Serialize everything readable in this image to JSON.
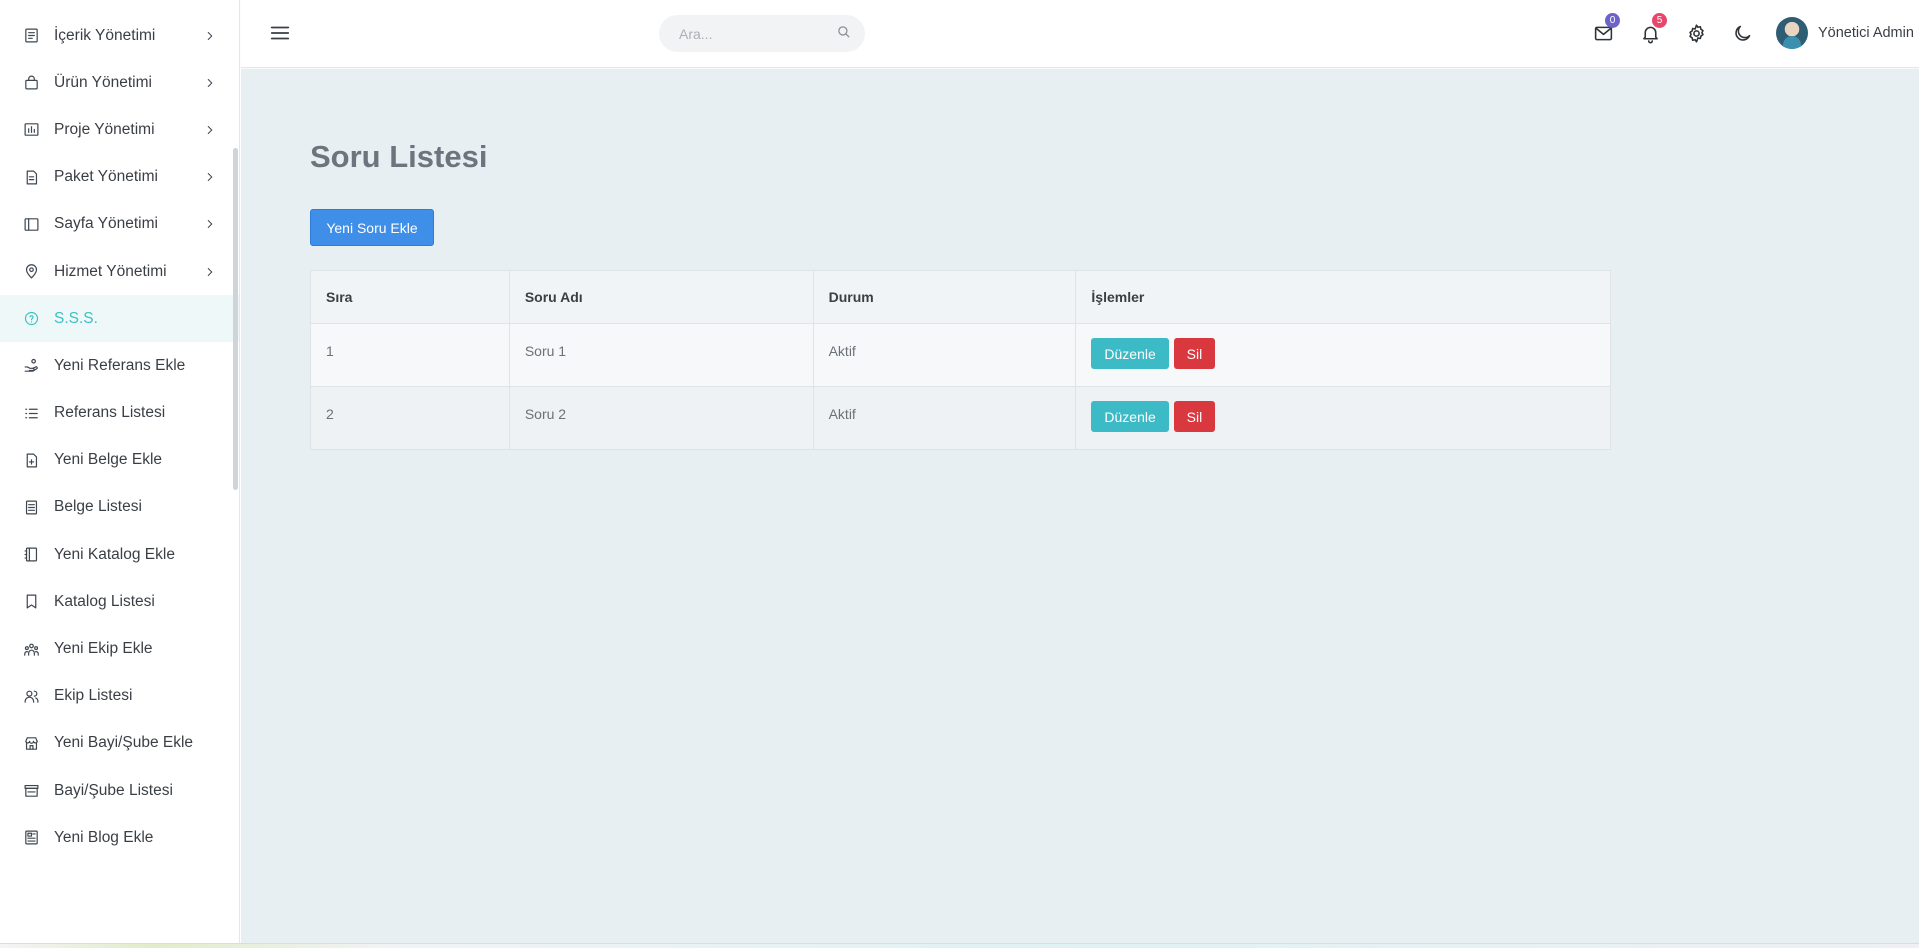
{
  "sidebar": {
    "items": [
      {
        "label": "İçerik Yönetimi",
        "icon": "document-list-icon",
        "has_chevron": true
      },
      {
        "label": "Ürün Yönetimi",
        "icon": "shopping-bag-icon",
        "has_chevron": true
      },
      {
        "label": "Proje Yönetimi",
        "icon": "bar-chart-icon",
        "has_chevron": true
      },
      {
        "label": "Paket Yönetimi",
        "icon": "file-text-icon",
        "has_chevron": true
      },
      {
        "label": "Sayfa Yönetimi",
        "icon": "layout-icon",
        "has_chevron": true
      },
      {
        "label": "Hizmet Yönetimi",
        "icon": "map-pin-icon",
        "has_chevron": true
      },
      {
        "label": "S.S.S.",
        "icon": "help-circle-icon",
        "has_chevron": false,
        "active": true
      },
      {
        "label": "Yeni Referans Ekle",
        "icon": "hand-coins-icon",
        "has_chevron": false
      },
      {
        "label": "Referans Listesi",
        "icon": "list-icon",
        "has_chevron": false
      },
      {
        "label": "Yeni Belge Ekle",
        "icon": "file-plus-icon",
        "has_chevron": false
      },
      {
        "label": "Belge Listesi",
        "icon": "document-list-icon",
        "has_chevron": false
      },
      {
        "label": "Yeni Katalog Ekle",
        "icon": "notebook-icon",
        "has_chevron": false
      },
      {
        "label": "Katalog Listesi",
        "icon": "bookmark-icon",
        "has_chevron": false
      },
      {
        "label": "Yeni Ekip Ekle",
        "icon": "team-icon",
        "has_chevron": false
      },
      {
        "label": "Ekip Listesi",
        "icon": "users-icon",
        "has_chevron": false
      },
      {
        "label": "Yeni Bayi/Şube Ekle",
        "icon": "store-icon",
        "has_chevron": false
      },
      {
        "label": "Bayi/Şube Listesi",
        "icon": "storefront-icon",
        "has_chevron": false
      },
      {
        "label": "Yeni Blog Ekle",
        "icon": "newspaper-icon",
        "has_chevron": false
      }
    ]
  },
  "header": {
    "search_placeholder": "Ara...",
    "mail_count": "0",
    "notification_count": "5",
    "user_name": "Yönetici Admin"
  },
  "main": {
    "title": "Soru Listesi",
    "add_button": "Yeni Soru Ekle",
    "table": {
      "headers": [
        "Sıra",
        "Soru Adı",
        "Durum",
        "İşlemler"
      ],
      "rows": [
        {
          "order": "1",
          "name": "Soru 1",
          "status": "Aktif",
          "edit": "Düzenle",
          "delete": "Sil"
        },
        {
          "order": "2",
          "name": "Soru 2",
          "status": "Aktif",
          "edit": "Düzenle",
          "delete": "Sil"
        }
      ]
    }
  },
  "colors": {
    "accent": "#3ec1c4",
    "primary_button": "#3f8ee8",
    "edit_button": "#3cbac6",
    "delete_button": "#d9383e",
    "content_bg": "#e8eff2"
  }
}
